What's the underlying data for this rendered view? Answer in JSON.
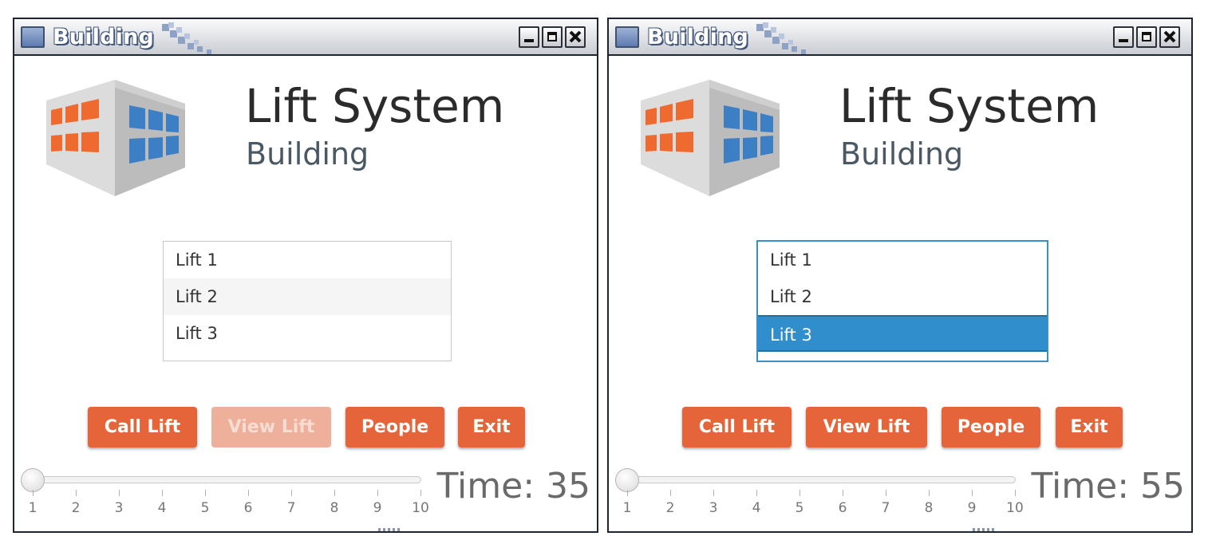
{
  "windows": [
    {
      "title": "Building",
      "heading": "Lift System",
      "subheading": "Building",
      "lifts": [
        "Lift 1",
        "Lift 2",
        "Lift 3"
      ],
      "selected_lift": null,
      "buttons": {
        "call_lift": "Call Lift",
        "view_lift": "View Lift",
        "view_lift_enabled": false,
        "people": "People",
        "exit": "Exit"
      },
      "slider": {
        "value": 1,
        "min": 1,
        "max": 10,
        "ticks": [
          "1",
          "2",
          "3",
          "4",
          "5",
          "6",
          "7",
          "8",
          "9",
          "10"
        ]
      },
      "time_text": "Time: 35"
    },
    {
      "title": "Building",
      "heading": "Lift System",
      "subheading": "Building",
      "lifts": [
        "Lift 1",
        "Lift 2",
        "Lift 3"
      ],
      "selected_lift": "Lift 3",
      "buttons": {
        "call_lift": "Call Lift",
        "view_lift": "View Lift",
        "view_lift_enabled": true,
        "people": "People",
        "exit": "Exit"
      },
      "slider": {
        "value": 1,
        "min": 1,
        "max": 10,
        "ticks": [
          "1",
          "2",
          "3",
          "4",
          "5",
          "6",
          "7",
          "8",
          "9",
          "10"
        ]
      },
      "time_text": "Time: 55"
    }
  ],
  "icons": {
    "app": "window-app-icon",
    "minimize": "minimize-icon",
    "maximize": "maximize-icon",
    "close": "close-icon",
    "logo": "building-logo-icon"
  },
  "colors": {
    "accent_button": "#e6643a",
    "selection": "#2f8ecb",
    "logo_orange": "#ef6a2e",
    "logo_blue": "#3d7fc4"
  }
}
